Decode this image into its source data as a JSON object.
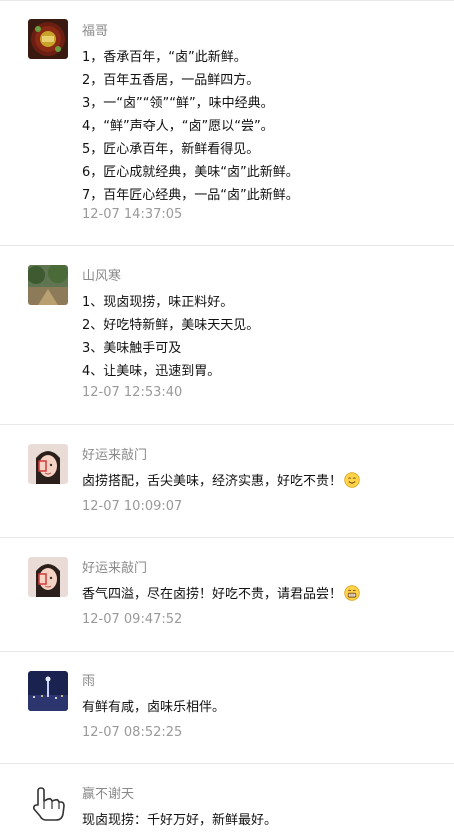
{
  "comments": [
    {
      "user": "福哥",
      "lines": [
        "1，香承百年，“卤”此新鲜。",
        "2，百年五香居，一品鲜四方。",
        "3，一“卤”“领”“鲜”，味中经典。",
        "4，“鲜”声夺人，“卤”愿以“尝”。",
        "5，匠心承百年，新鲜看得见。",
        "6，匠心成就经典，美味“卤”此新鲜。",
        "7，百年匠心经典，一品“卤”此新鲜。"
      ],
      "time": "12-07 14:37:05"
    },
    {
      "user": "山风寒",
      "lines": [
        "1、现卤现捞，味正料好。",
        "2、好吃特新鲜，美味天天见。",
        "3、美味触手可及",
        "4、让美味，迅速到胃。"
      ],
      "time": "12-07 12:53:40"
    },
    {
      "user": "好运来敲门",
      "lines": [
        "卤捞搭配，舌尖美味，经济实惠，好吃不贵！"
      ],
      "emoji": "smile-emoji-icon",
      "time": "12-07 10:09:07"
    },
    {
      "user": "好运来敲门",
      "lines": [
        "香气四溢，尽在卤捞！好吃不贵，请君品尝！"
      ],
      "emoji": "grin-emoji-icon",
      "time": "12-07 09:47:52"
    },
    {
      "user": "雨",
      "lines": [
        "有鲜有咸，卤味乐相伴。"
      ],
      "time": "12-07 08:52:25"
    },
    {
      "user": "赢不谢天",
      "lines": [
        "现卤现捞：千好万好，新鲜最好。"
      ],
      "time": ""
    }
  ]
}
